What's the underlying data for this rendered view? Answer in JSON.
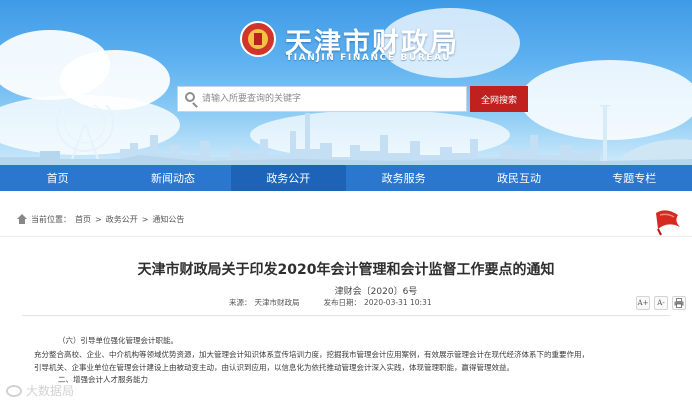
{
  "header": {
    "site_title": "天津市财政局",
    "site_subtitle": "TIANJIN FINANCE BUREAU",
    "search_placeholder": "请输入所要查询的关键字",
    "search_button": "全网搜索"
  },
  "nav": {
    "items": [
      {
        "label": "首页"
      },
      {
        "label": "新闻动态"
      },
      {
        "label": "政务公开"
      },
      {
        "label": "政务服务"
      },
      {
        "label": "政民互动"
      },
      {
        "label": "专题专栏"
      }
    ],
    "active_index": 2
  },
  "breadcrumb": {
    "prefix": "当前位置：",
    "items": [
      "首页",
      "政务公开",
      "通知公告"
    ],
    "separator": ">"
  },
  "article": {
    "title": "天津市财政局关于印发2020年会计管理和会计监督工作要点的通知",
    "doc_number": "津财会〔2020〕6号",
    "source_label": "来源：",
    "source_value": "天津市财政局",
    "date_label": "发布日期：",
    "date_value": "2020-03-31 10:31",
    "tools": {
      "font_larger": "A+",
      "font_smaller": "A-",
      "print": "print-icon"
    },
    "paragraphs": [
      "（六）引导单位强化管理会计职能。",
      "充分整合高校、企业、中介机构等领域优势资源，加大管理会计知识体系宣传培训力度，挖掘我市管理会计应用案例，有效展示管理会计在现代经济体系下的重要作用，",
      "引导机关、企事业单位在管理会计建设上由被动变主动，由认识到应用，以信息化为依托推动管理会计深入实践，体现管理职能，赢得管理效益。",
      "二、增强会计人才服务能力"
    ]
  },
  "watermark": {
    "text": "大数据局"
  },
  "colors": {
    "nav_bg": "#2b77cf",
    "nav_active": "#1d64b8",
    "search_button": "#c0201e",
    "sky_top": "#3f9ae6"
  }
}
